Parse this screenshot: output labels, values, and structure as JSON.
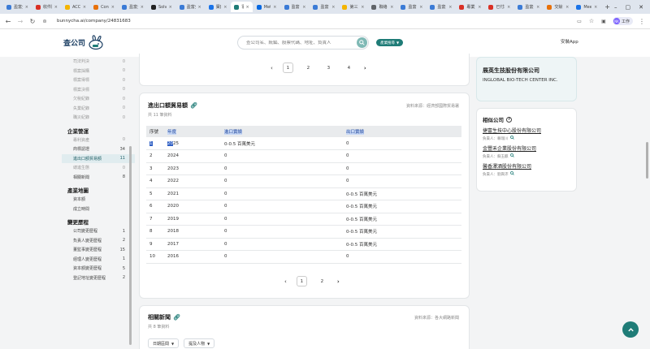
{
  "browser": {
    "tabs": [
      {
        "label": "盈富分",
        "color": "#3b7bd6"
      },
      {
        "label": "收件匣",
        "color": "#d93025"
      },
      {
        "label": "ACCU",
        "color": "#f4b400"
      },
      {
        "label": "Contr",
        "color": "#e8710a"
      },
      {
        "label": "盈富分",
        "color": "#3b7bd6"
      },
      {
        "label": "Solve",
        "color": "#222222"
      },
      {
        "label": "盈富分",
        "color": "#3b7bd6"
      },
      {
        "label": "寶藏",
        "color": "#1a73e8"
      },
      {
        "label": "寰",
        "color": "#1f7c77",
        "active": true
      },
      {
        "label": "Meta",
        "color": "#0668e1"
      },
      {
        "label": "盈富分",
        "color": "#3b7bd6"
      },
      {
        "label": "盈富分",
        "color": "#3b7bd6"
      },
      {
        "label": "第三方",
        "color": "#f4b400"
      },
      {
        "label": "聯絡中",
        "color": "#5f6368"
      },
      {
        "label": "盈富分",
        "color": "#3b7bd6"
      },
      {
        "label": "盈富分",
        "color": "#3b7bd6"
      },
      {
        "label": "專業分",
        "color": "#d93025"
      },
      {
        "label": "已付款",
        "color": "#d93025"
      },
      {
        "label": "盈富分",
        "color": "#3b7bd6"
      },
      {
        "label": "交餘分",
        "color": "#e8710a"
      },
      {
        "label": "Meeti",
        "color": "#1a73e8"
      }
    ],
    "url": "bunnycha.ai/company/24831683",
    "profile_label": "工作",
    "profile_initials": "NK"
  },
  "header": {
    "logo_text": "查公司",
    "search_placeholder": "查公司名、統編、股票代碼、地址、負責人",
    "industry_button": "產業搜尋",
    "app_link": "安裝App"
  },
  "sidebar": {
    "top_items": [
      {
        "label": "司法判決",
        "count": "0"
      },
      {
        "label": "標案採購",
        "count": "0"
      },
      {
        "label": "標案得標",
        "count": "0"
      },
      {
        "label": "標案決標",
        "count": "0"
      },
      {
        "label": "欠稅紀錄",
        "count": "0"
      },
      {
        "label": "失業紀錄",
        "count": "0"
      },
      {
        "label": "職災紀錄",
        "count": "0"
      }
    ],
    "section_mgmt": "企業營運",
    "mgmt_items": [
      {
        "label": "專利資產",
        "count": "0",
        "style": "muted"
      },
      {
        "label": "商標認證",
        "count": "34",
        "style": "dark"
      },
      {
        "label": "進出口額貿易額",
        "count": "11",
        "style": "active"
      },
      {
        "label": "總進生態",
        "count": "0",
        "style": "muted"
      },
      {
        "label": "相關新聞",
        "count": "8",
        "style": "dark"
      }
    ],
    "section_map": "產業地圖",
    "map_items": [
      {
        "label": "資本額",
        "count": ""
      },
      {
        "label": "成立時間",
        "count": ""
      }
    ],
    "section_change": "變更歷程",
    "change_items": [
      {
        "label": "公司變更歷程",
        "count": "1"
      },
      {
        "label": "負責人變更歷程",
        "count": "2"
      },
      {
        "label": "董監事變更歷程",
        "count": "15"
      },
      {
        "label": "經理人變更歷程",
        "count": "1"
      },
      {
        "label": "資本額變更歷程",
        "count": "5"
      },
      {
        "label": "登記地址變更歷程",
        "count": "2"
      }
    ]
  },
  "top_pager": {
    "pages": [
      "1",
      "2",
      "3",
      "4"
    ],
    "current": "1"
  },
  "import_export": {
    "title": "進出口額貿易額",
    "subtitle": "共 11 筆資料",
    "source": "資料來源：經濟部國際貿易署",
    "columns": [
      "序號",
      "年度",
      "進口實績",
      "出口實績"
    ],
    "rows": [
      [
        "1",
        "2025",
        "0-0.5 百萬美元",
        "0"
      ],
      [
        "2",
        "2024",
        "0",
        "0"
      ],
      [
        "3",
        "2023",
        "0",
        "0"
      ],
      [
        "4",
        "2022",
        "0",
        "0"
      ],
      [
        "5",
        "2021",
        "0",
        "0-0.5 百萬美元"
      ],
      [
        "6",
        "2020",
        "0",
        "0-0.5 百萬美元"
      ],
      [
        "7",
        "2019",
        "0",
        "0-0.5 百萬美元"
      ],
      [
        "8",
        "2018",
        "0",
        "0-0.5 百萬美元"
      ],
      [
        "9",
        "2017",
        "0",
        "0-0.5 百萬美元"
      ],
      [
        "10",
        "2016",
        "0",
        "0"
      ]
    ],
    "pager": {
      "pages": [
        "1",
        "2"
      ],
      "current": "1"
    }
  },
  "news": {
    "title": "相關新聞",
    "subtitle": "共 8 筆資料",
    "source": "資料來源：各大網路新聞",
    "filter_date": "日期區間",
    "filter_person": "提及人物"
  },
  "company_card": {
    "name": "展英生技股份有限公司",
    "name_en": "INGLOBAL BIO-TECH CENTER INC."
  },
  "similar": {
    "title": "相似公司",
    "items": [
      {
        "name": "捷富生技中心股份有限公司",
        "rep": "負責人：賴瑞川"
      },
      {
        "name": "金豐禾企業股份有限公司",
        "rep": "負責人：蘇玉麒"
      },
      {
        "name": "馨香澤酒股份有限公司",
        "rep": "負責人：劉興沛"
      }
    ]
  }
}
